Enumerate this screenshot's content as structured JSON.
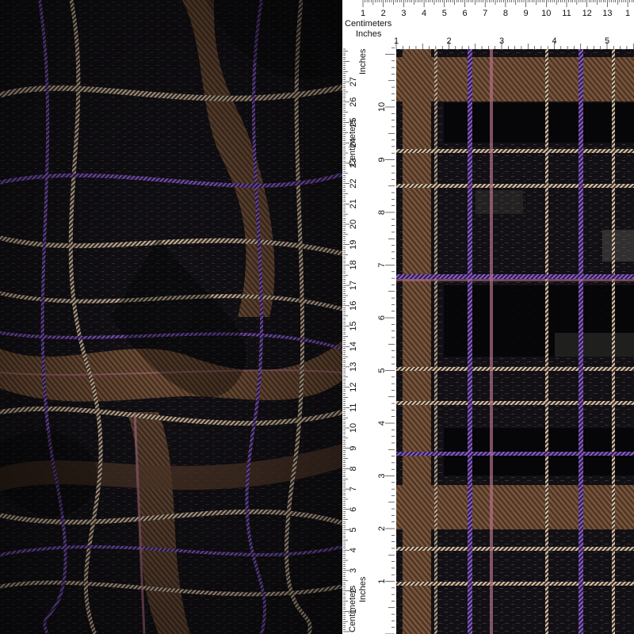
{
  "palette": {
    "base": "#121015",
    "dark_block": "#060507",
    "brown": "#6a4a32",
    "brown_light": "#8a6446",
    "purple": "#7a52b8",
    "pink": "#b07088",
    "cream": "#d8c4a8",
    "grey_texture": "#6c6a60",
    "ruler_bg": "#ffffff",
    "ruler_ink": "#111111"
  },
  "top_ruler": {
    "label_cm": "Centimeters",
    "label_in": "Inches",
    "cm_numbers": [
      "1",
      "2",
      "3",
      "4",
      "5",
      "6",
      "7",
      "8",
      "9",
      "10",
      "11",
      "12",
      "13",
      "1"
    ],
    "in_numbers": [
      "1",
      "2",
      "3",
      "4",
      "5"
    ]
  },
  "left_ruler": {
    "label_cm": "Centimeters",
    "label_in": "Inches",
    "cm_numbers": [
      "1",
      "2",
      "3",
      "4",
      "5",
      "6",
      "7",
      "8",
      "9",
      "10",
      "11",
      "12",
      "13",
      "14",
      "15",
      "16",
      "17",
      "18",
      "19",
      "20",
      "21",
      "22",
      "23",
      "24",
      "25",
      "26",
      "27"
    ],
    "in_numbers": [
      "1",
      "2",
      "3",
      "4",
      "5",
      "6",
      "7",
      "8",
      "9",
      "10"
    ]
  }
}
